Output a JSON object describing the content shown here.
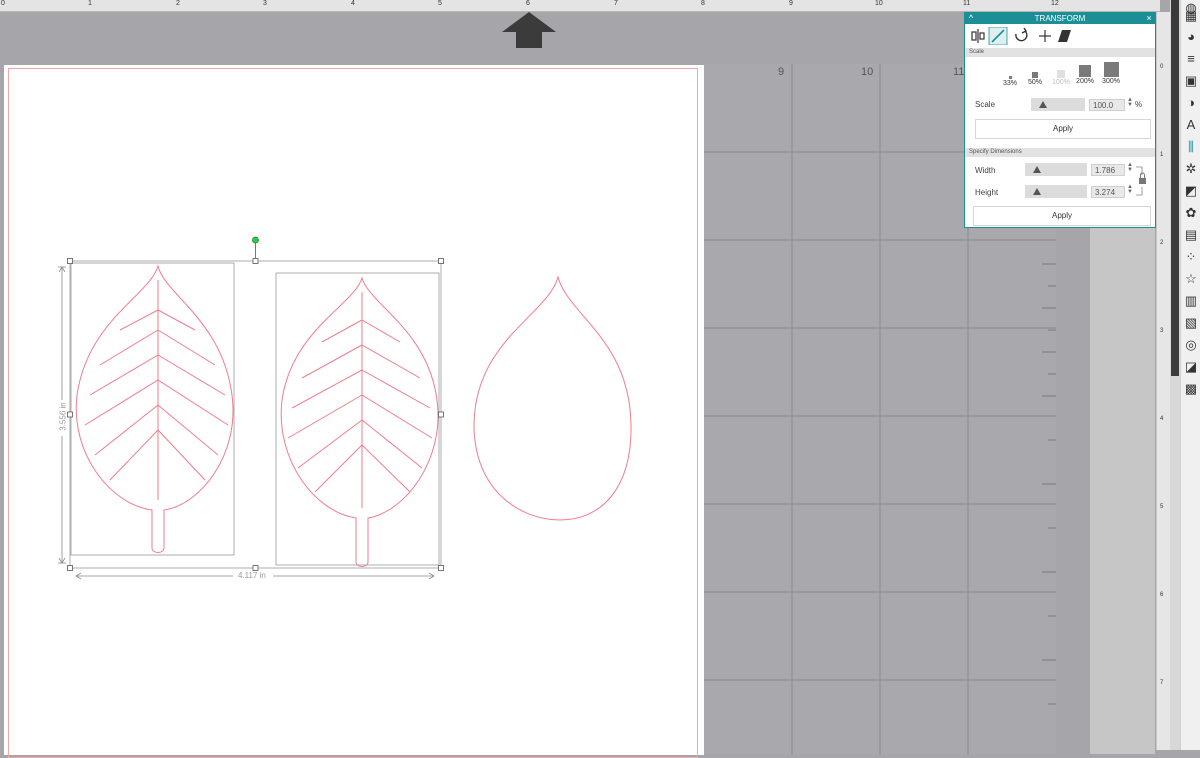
{
  "ruler_top": [
    "0",
    "1",
    "2",
    "3",
    "4",
    "5",
    "6",
    "7",
    "8",
    "9",
    "10",
    "11",
    "12"
  ],
  "grid_labels": [
    "9",
    "10",
    "11"
  ],
  "ruler_right": [
    "0",
    "1",
    "2",
    "3",
    "4",
    "5",
    "6",
    "7"
  ],
  "panel": {
    "title": "TRANSFORM",
    "collapse_symbol": "^",
    "close_symbol": "×",
    "scale_section": "Scale",
    "presets": [
      "33%",
      "50%",
      "100%",
      "200%",
      "300%"
    ],
    "scale_label": "Scale",
    "scale_value": "100.0",
    "percent": "%",
    "apply_label": "Apply",
    "dims_section": "Specify Dimensions",
    "width_label": "Width",
    "width_value": "1.786",
    "height_label": "Height",
    "height_value": "3.274",
    "apply2_label": "Apply"
  },
  "measure": {
    "height": "3.556 in",
    "width": "4.117 in"
  },
  "colors": {
    "accent": "#1c8f96",
    "cut_line": "#f07d8a",
    "canvas_gray": "#a6a5aa"
  }
}
